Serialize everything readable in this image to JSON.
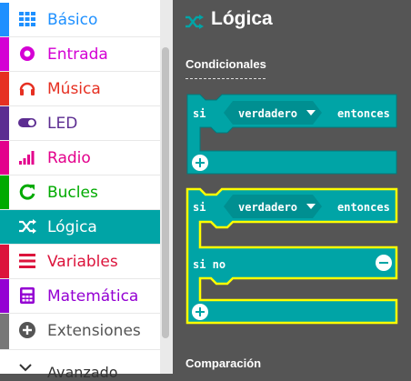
{
  "sidebar": {
    "items": [
      {
        "label": "Básico",
        "color": "#1e90ff",
        "icon": "grid-icon"
      },
      {
        "label": "Entrada",
        "color": "#d400d4",
        "icon": "target-icon"
      },
      {
        "label": "Música",
        "color": "#e63022",
        "icon": "headphones-icon"
      },
      {
        "label": "LED",
        "color": "#5c2d91",
        "icon": "toggle-icon"
      },
      {
        "label": "Radio",
        "color": "#e3008c",
        "icon": "signal-bars-icon"
      },
      {
        "label": "Bucles",
        "color": "#00aa00",
        "icon": "loop-arrow-icon"
      },
      {
        "label": "Lógica",
        "color": "#00a4a6",
        "icon": "shuffle-icon"
      },
      {
        "label": "Variables",
        "color": "#dc143c",
        "icon": "list-icon"
      },
      {
        "label": "Matemática",
        "color": "#9400d3",
        "icon": "calculator-icon"
      },
      {
        "label": "Extensiones",
        "color": "#777777",
        "icon": "plus-circle-icon"
      }
    ],
    "selected_index": 6,
    "bottom_item": "Avanzado"
  },
  "flyout": {
    "title": "Lógica",
    "sections": [
      "Condicionales",
      "Comparación"
    ],
    "blocks": [
      {
        "if_keyword": "si",
        "condition": "verdadero",
        "then_keyword": "entonces"
      },
      {
        "if_keyword": "si",
        "condition": "verdadero",
        "then_keyword": "entonces",
        "else_keyword": "si no"
      }
    ]
  },
  "colors": {
    "logic": "#00a4a6",
    "highlight": "#ffff00",
    "flyout_bg": "#555555"
  }
}
